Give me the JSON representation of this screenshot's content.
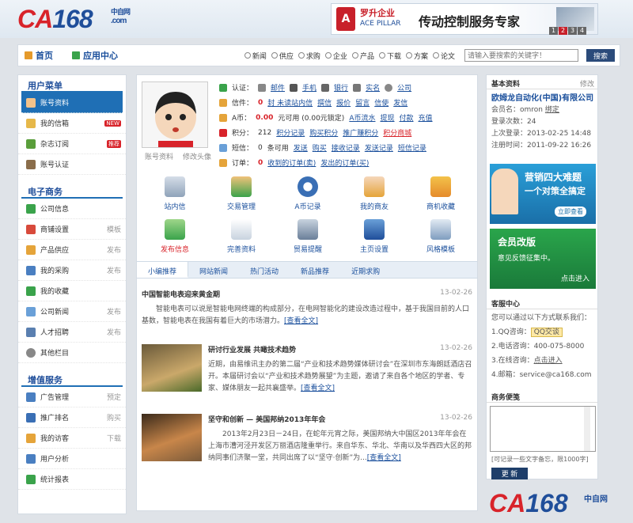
{
  "header": {
    "logo_text": "CA168",
    "logo_sub_cn": "中自网",
    "logo_sub_en": ".com",
    "banner_company_cn": "罗升企业",
    "banner_company_en": "ACE PILLAR",
    "banner_slogan": "传动控制服务专家",
    "banner_pages": [
      "1",
      "2",
      "3",
      "4"
    ]
  },
  "nav": {
    "home": "首页",
    "app_center": "应用中心",
    "search_types": [
      "新闻",
      "供应",
      "求购",
      "企业",
      "产品",
      "下载",
      "方案",
      "论文"
    ],
    "search_placeholder": "请输入要搜索的关键字！",
    "search_button": "搜索"
  },
  "sidebar": {
    "user_menu_title": "用户菜单",
    "user_items": [
      {
        "label": "账号资料"
      },
      {
        "label": "我的信箱",
        "badge": "NEW"
      },
      {
        "label": "杂志订阅",
        "badge": "推荐"
      },
      {
        "label": "账号认证"
      }
    ],
    "ecommerce_title": "电子商务",
    "ecommerce_items": [
      {
        "label": "公司信息",
        "tag": ""
      },
      {
        "label": "商铺设置",
        "tag": "模板"
      },
      {
        "label": "产品供应",
        "tag": "发布"
      },
      {
        "label": "我的采购",
        "tag": "发布"
      },
      {
        "label": "我的收藏",
        "tag": ""
      },
      {
        "label": "公司新闻",
        "tag": "发布"
      },
      {
        "label": "人才招聘",
        "tag": "发布"
      },
      {
        "label": "其他栏目",
        "tag": ""
      }
    ],
    "value_title": "增值服务",
    "value_items": [
      {
        "label": "广告管理",
        "tag": "预定"
      },
      {
        "label": "推广排名",
        "tag": "购买"
      },
      {
        "label": "我的访客",
        "tag": "下载"
      },
      {
        "label": "用户分析",
        "tag": ""
      },
      {
        "label": "统计报表",
        "tag": ""
      }
    ]
  },
  "profile": {
    "caption_left": "账号资料",
    "caption_right": "修改头像"
  },
  "info": {
    "r1": {
      "label": "认证：",
      "items": [
        "邮件",
        "手机",
        "银行",
        "实名",
        "公司"
      ]
    },
    "r2": {
      "label": "信件：",
      "count": "0",
      "text": "封 未读站内信",
      "links": [
        "撰信",
        "报价",
        "留言",
        "信使",
        "发信"
      ]
    },
    "r3": {
      "label": "A币：",
      "amount": "0.00",
      "text": "元可用 (0.00元锁定)",
      "links": [
        "A币流水",
        "提现",
        "付款",
        "充值"
      ]
    },
    "r4": {
      "label": "积分：",
      "amount": "212",
      "links": [
        "积分记录",
        "购买积分",
        "推广赚积分",
        "积分商城"
      ]
    },
    "r5": {
      "label": "短信：",
      "count": "0",
      "text": "条可用",
      "links": [
        "发送",
        "购买",
        "接收记录",
        "发送记录",
        "短信记录"
      ]
    },
    "r6": {
      "label": "订单：",
      "count": "0",
      "links": [
        "收到的订单(卖)",
        "发出的订单(买)"
      ]
    }
  },
  "quick": [
    [
      "站内信",
      "交易管理",
      "A币记录",
      "我的商友",
      "商机收藏"
    ],
    [
      "发布信息",
      "完善资料",
      "贸易提醒",
      "主页设置",
      "风格模板"
    ]
  ],
  "tabs": [
    "小编推荐",
    "网站新闻",
    "热门活动",
    "新品推荐",
    "近期求购"
  ],
  "news": [
    {
      "title": "中国智能电表迎来黄金期",
      "date": "13-02-26",
      "desc": "智能电表可以说是智能电网终端的构成部分，在电网智能化的建设改造过程中，基于我国目前的人口基数，智能电表在我国有着巨大的市场潜力。",
      "more": "[查看全文]"
    },
    {
      "title": "研讨行业发展 共瞰技术趋势",
      "date": "13-02-26",
      "desc": "近期，由易维讯主办的第二届“产业和技术趋势媒体研讨会”在深圳市东海朗廷酒店召开。本届研讨会以“产业和技术趋势展望”为主题，邀请了来自各个地区的学者、专家、媒体朋友一起共襄盛举。",
      "more": "[查看全文]"
    },
    {
      "title": "坚守和创新 — 美国邦纳2013年年会",
      "date": "13-02-26",
      "desc": "2013年2月23日－24日，在蛇年元宵之际，美国邦纳大中国区2013年年会在上海市漕河泾开发区万丽酒店隆重举行。来自华东、华北、华南以及华西四大区的邦纳同事们济聚一堂，共同出席了以“坚守·创新”为...",
      "more": "[查看全文]"
    }
  ],
  "account": {
    "title": "基本资料",
    "edit": "修改",
    "company": "欧姆龙自动化(中国)有限公司",
    "member_label": "会员名：",
    "member": "omron",
    "bind": "绑定",
    "login_count_label": "登录次数：",
    "login_count": "24",
    "last_login_label": "上次登录：",
    "last_login": "2013-02-25 14:48",
    "register_label": "注册时间：",
    "register": "2011-09-22 16:26"
  },
  "promo1": {
    "line1": "营销四大难题",
    "line2": "一个对策全搞定",
    "button": "立即查看"
  },
  "promo2": {
    "line1": "会员改版",
    "line2": "意见反馈征集中。",
    "button": "点击进入"
  },
  "service": {
    "title": "客服中心",
    "intro": "您可以通过以下方式联系我们：",
    "qq_label": "1.QQ咨询：",
    "qq_button": "QQ交谈",
    "phone_label": "2.电话咨询：",
    "phone": "400-075-8000",
    "online_label": "3.在线咨询：",
    "online": "点击进入",
    "email_label": "4.邮箱：",
    "email": "service@ca168.com"
  },
  "memo": {
    "title": "商务便笺",
    "hint": "[可记录一些文字备忘，限1000字]",
    "button": "更 新"
  }
}
